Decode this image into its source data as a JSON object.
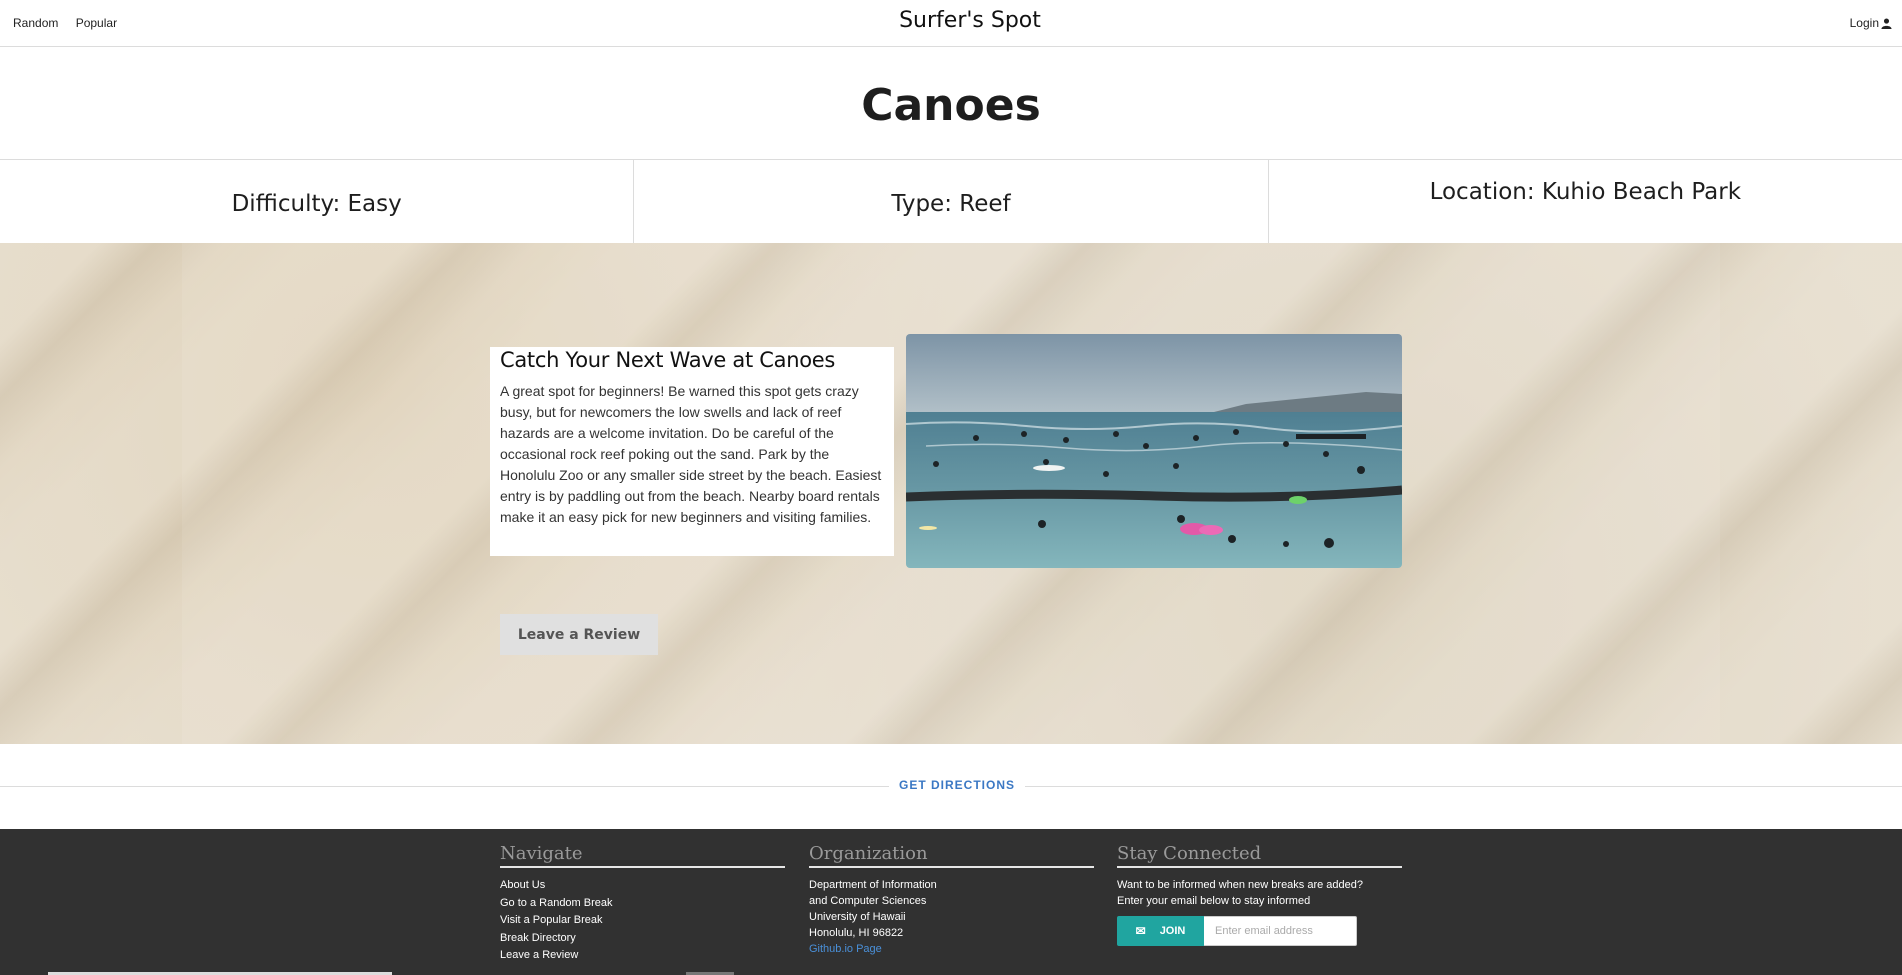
{
  "nav": {
    "random": "Random",
    "popular": "Popular",
    "brand": "Surfer's Spot",
    "login": "Login"
  },
  "spot": {
    "name": "Canoes",
    "difficulty": "Difficulty: Easy",
    "type": "Type: Reef",
    "location": "Location: Kuhio Beach Park"
  },
  "description": {
    "heading": "Catch Your Next Wave at Canoes",
    "body": "A great spot for beginners! Be warned this spot gets crazy busy, but for newcomers the low swells and lack of reef hazards are a welcome invitation. Do be careful of the occasional rock reef poking out the sand. Park by the Honolulu Zoo or any smaller side street by the beach. Easiest entry is by paddling out from the beach. Nearby board rentals make it an easy pick for new beginners and visiting families."
  },
  "review_button": "Leave a Review",
  "directions": "GET DIRECTIONS",
  "footer": {
    "navigate": {
      "heading": "Navigate",
      "items": [
        "About Us",
        "Go to a Random Break",
        "Visit a Popular Break",
        "Break Directory",
        "Leave a Review"
      ]
    },
    "organization": {
      "heading": "Organization",
      "lines": [
        "Department of Information",
        "and Computer Sciences",
        "University of Hawaii",
        "Honolulu, HI 96822"
      ],
      "link": "Github.io Page"
    },
    "stay": {
      "heading": "Stay Connected",
      "line1": "Want to be informed when new breaks are added?",
      "line2": "Enter your email below to stay informed",
      "join": "JOIN",
      "placeholder": "Enter email address"
    }
  },
  "colors": {
    "accent_teal": "#20a5a0",
    "link_blue": "#3b78c4",
    "footer_bg": "#313131"
  }
}
